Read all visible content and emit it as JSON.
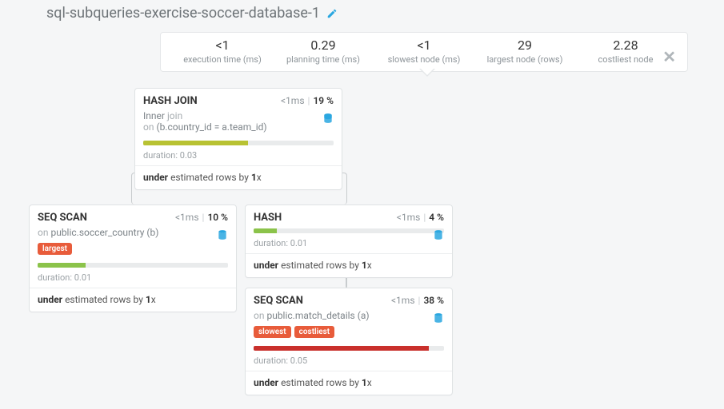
{
  "title": "sql-subqueries-exercise-soccer-database-1",
  "stats": {
    "exec_time": {
      "value": "<1",
      "label": "execution time (ms)"
    },
    "plan_time": {
      "value": "0.29",
      "label": "planning time (ms)"
    },
    "slowest": {
      "value": "<1",
      "label": "slowest node (ms)"
    },
    "largest": {
      "value": "29",
      "label": "largest node (rows)"
    },
    "costliest": {
      "value": "2.28",
      "label": "costliest node"
    }
  },
  "nodes": {
    "hashjoin": {
      "title": "HASH JOIN",
      "time": "<1ms",
      "pct": "19 %",
      "sub1_a": "Inner",
      "sub1_b": "join",
      "sub2_a": "on",
      "sub2_b": "(b.country_id = a.team_id)",
      "duration_lbl": "duration:",
      "duration_val": "0.03",
      "est_a": "under",
      "est_b": "estimated rows by",
      "est_c": "1",
      "est_d": "x",
      "bar_pct": 55,
      "bar_class": "olive"
    },
    "seqscan1": {
      "title": "SEQ SCAN",
      "time": "<1ms",
      "pct": "10 %",
      "sub_a": "on",
      "sub_b": "public.soccer_country (b)",
      "tag1": "largest",
      "duration_lbl": "duration:",
      "duration_val": "0.01",
      "est_a": "under",
      "est_b": "estimated rows by",
      "est_c": "1",
      "est_d": "x",
      "bar_pct": 25,
      "bar_class": "green"
    },
    "hash": {
      "title": "HASH",
      "time": "<1ms",
      "pct": "4 %",
      "duration_lbl": "duration:",
      "duration_val": "0.01",
      "est_a": "under",
      "est_b": "estimated rows by",
      "est_c": "1",
      "est_d": "x",
      "bar_pct": 12,
      "bar_class": "green"
    },
    "seqscan2": {
      "title": "SEQ SCAN",
      "time": "<1ms",
      "pct": "38 %",
      "sub_a": "on",
      "sub_b": "public.match_details (a)",
      "tag1": "slowest",
      "tag2": "costliest",
      "duration_lbl": "duration:",
      "duration_val": "0.05",
      "est_a": "under",
      "est_b": "estimated rows by",
      "est_c": "1",
      "est_d": "x",
      "bar_pct": 92,
      "bar_class": "red"
    }
  }
}
